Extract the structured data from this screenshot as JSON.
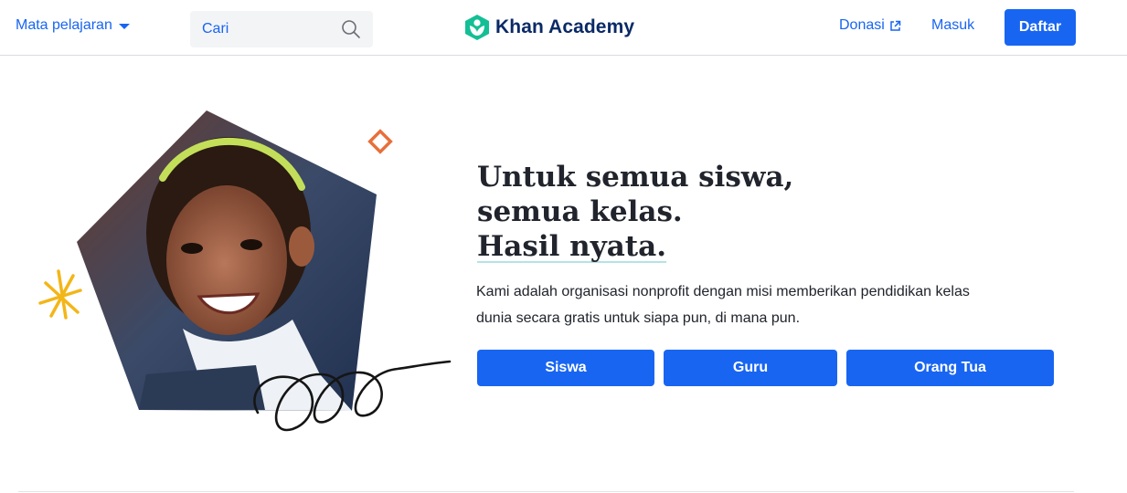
{
  "header": {
    "subjects_label": "Mata pelajaran",
    "search_placeholder": "Cari",
    "logo_text": "Khan Academy",
    "donate_label": "Donasi",
    "login_label": "Masuk",
    "signup_label": "Daftar"
  },
  "hero": {
    "title_lines": [
      "Untuk semua siswa,",
      "semua kelas.",
      "Hasil nyata."
    ],
    "description_lines": [
      "Kami adalah organisasi nonprofit dengan misi memberikan pendidikan kelas",
      "dunia secara gratis untuk siapa pun, di mana pun."
    ],
    "buttons": [
      "Siswa",
      "Guru",
      "Orang Tua"
    ]
  },
  "icons": {
    "caret": "chevron-down-icon",
    "search": "search-icon",
    "logo": "khan-academy-logo-icon",
    "external": "external-link-icon"
  },
  "colors": {
    "primary": "#1865f2",
    "logo_text": "#0a2a66",
    "logo_mark": "#14bf96",
    "title_underline": "#b5e3e6",
    "accent_orange": "#e86f3a",
    "accent_yellow": "#f3b618"
  }
}
